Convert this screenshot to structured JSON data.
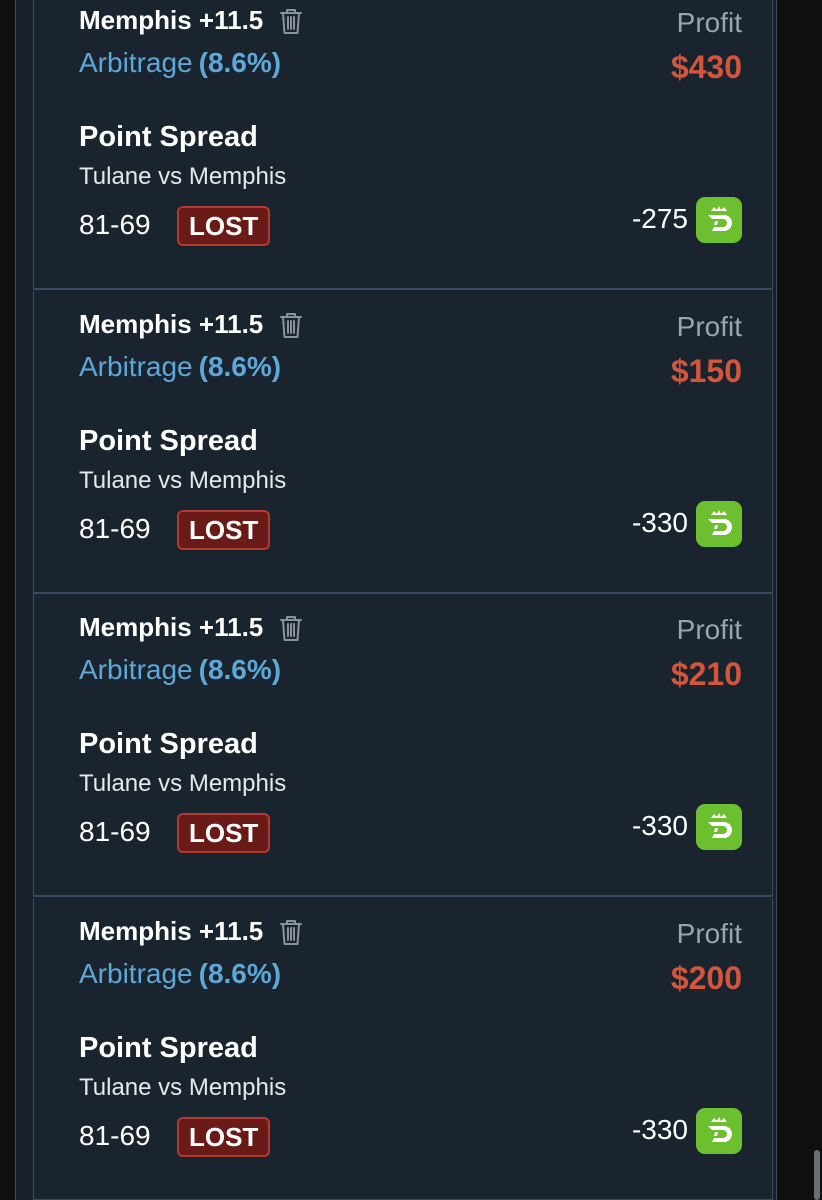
{
  "bets": [
    {
      "title": "Memphis +11.5",
      "type_label": "Arbitrage",
      "percentage": "(8.6%)",
      "profit_label": "Profit",
      "profit_value": "$430",
      "market": "Point Spread",
      "matchup": "Tulane vs Memphis",
      "score": "81-69",
      "result": "LOST",
      "odds": "-275",
      "book_icon": "draftkings-logo-icon"
    },
    {
      "title": "Memphis +11.5",
      "type_label": "Arbitrage",
      "percentage": "(8.6%)",
      "profit_label": "Profit",
      "profit_value": "$150",
      "market": "Point Spread",
      "matchup": "Tulane vs Memphis",
      "score": "81-69",
      "result": "LOST",
      "odds": "-330",
      "book_icon": "draftkings-logo-icon"
    },
    {
      "title": "Memphis +11.5",
      "type_label": "Arbitrage",
      "percentage": "(8.6%)",
      "profit_label": "Profit",
      "profit_value": "$210",
      "market": "Point Spread",
      "matchup": "Tulane vs Memphis",
      "score": "81-69",
      "result": "LOST",
      "odds": "-330",
      "book_icon": "draftkings-logo-icon"
    },
    {
      "title": "Memphis +11.5",
      "type_label": "Arbitrage",
      "percentage": "(8.6%)",
      "profit_label": "Profit",
      "profit_value": "$200",
      "market": "Point Spread",
      "matchup": "Tulane vs Memphis",
      "score": "81-69",
      "result": "LOST",
      "odds": "-330",
      "book_icon": "draftkings-logo-icon"
    }
  ],
  "colors": {
    "background": "#17212c",
    "arbitrage_blue": "#5ea8d8",
    "profit_red": "#d2553c",
    "lost_badge_bg": "#6a1a17",
    "lost_badge_border": "#b33a30",
    "book_green": "#6cbf2f"
  }
}
